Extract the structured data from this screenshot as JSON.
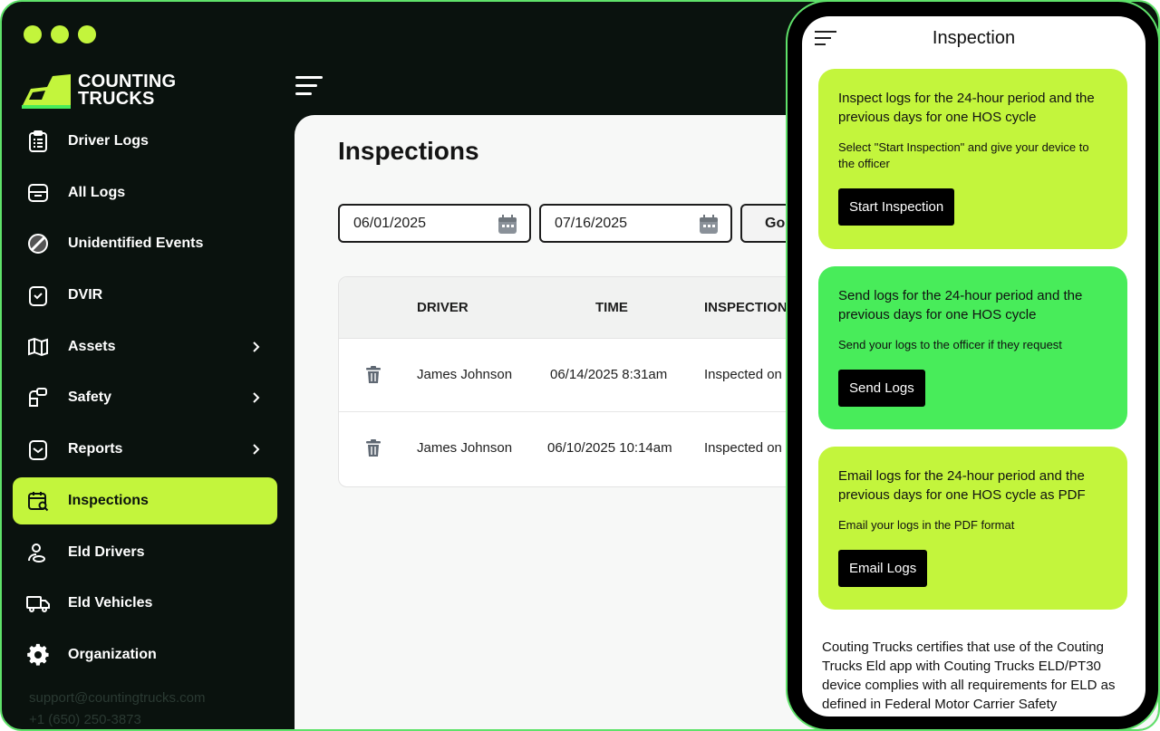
{
  "app": {
    "brand": {
      "line1": "COUNTING",
      "line2": "TRUCKS"
    },
    "accent_color": "#c3f53c",
    "accent_green": "#48ec5a",
    "sidebar_bg": "#0a120e"
  },
  "sidebar": {
    "items": [
      {
        "label": "Driver Logs",
        "icon": "clipboard-list-icon",
        "has_chevron": false
      },
      {
        "label": "All Logs",
        "icon": "archive-icon",
        "has_chevron": false
      },
      {
        "label": "Unidentified Events",
        "icon": "slash-circle-icon",
        "has_chevron": false
      },
      {
        "label": "DVIR",
        "icon": "clipboard-check-icon",
        "has_chevron": false
      },
      {
        "label": "Assets",
        "icon": "map-icon",
        "has_chevron": true
      },
      {
        "label": "Safety",
        "icon": "safety-icon",
        "has_chevron": true
      },
      {
        "label": "Reports",
        "icon": "report-icon",
        "has_chevron": true
      },
      {
        "label": "Inspections",
        "icon": "calendar-search-icon",
        "has_chevron": false,
        "active": true
      },
      {
        "label": "Eld Drivers",
        "icon": "users-icon",
        "has_chevron": false
      },
      {
        "label": "Eld Vehicles",
        "icon": "truck-icon",
        "has_chevron": false
      },
      {
        "label": "Organization",
        "icon": "gear-icon",
        "has_chevron": false
      }
    ],
    "support_email": "support@countingtrucks.com",
    "support_phone": "+1 (650) 250-3873"
  },
  "main": {
    "title": "Inspections",
    "date_from": "06/01/2025",
    "date_to": "07/16/2025",
    "go_label": "Go",
    "table": {
      "headers": [
        "DRIVER",
        "TIME",
        "INSPECTION"
      ],
      "rows": [
        {
          "driver": "James Johnson",
          "time": "06/14/2025 8:31am",
          "inspection": "Inspected on"
        },
        {
          "driver": "James Johnson",
          "time": "06/10/2025 10:14am",
          "inspection": "Inspected on"
        }
      ]
    }
  },
  "phone": {
    "title": "Inspection",
    "cards": [
      {
        "title": "Inspect logs for the 24-hour period and the previous days for one HOS cycle",
        "subtitle": "Select \"Start Inspection\" and give your device to the officer",
        "button": "Start Inspection"
      },
      {
        "title": "Send logs for the 24-hour period and the previous days for one HOS cycle",
        "subtitle": "Send your logs to the officer if they request",
        "button": "Send Logs"
      },
      {
        "title": "Email logs for the 24-hour period and the previous days for one HOS cycle as PDF",
        "subtitle": "Email your logs in the PDF format",
        "button": "Email Logs"
      }
    ],
    "certification": "Couting Trucks certifies that use of the Couting Trucks Eld app with Couting Trucks ELD/PT30 device complies with all requirements for ELD as defined in Federal Motor Carrier Safety"
  }
}
